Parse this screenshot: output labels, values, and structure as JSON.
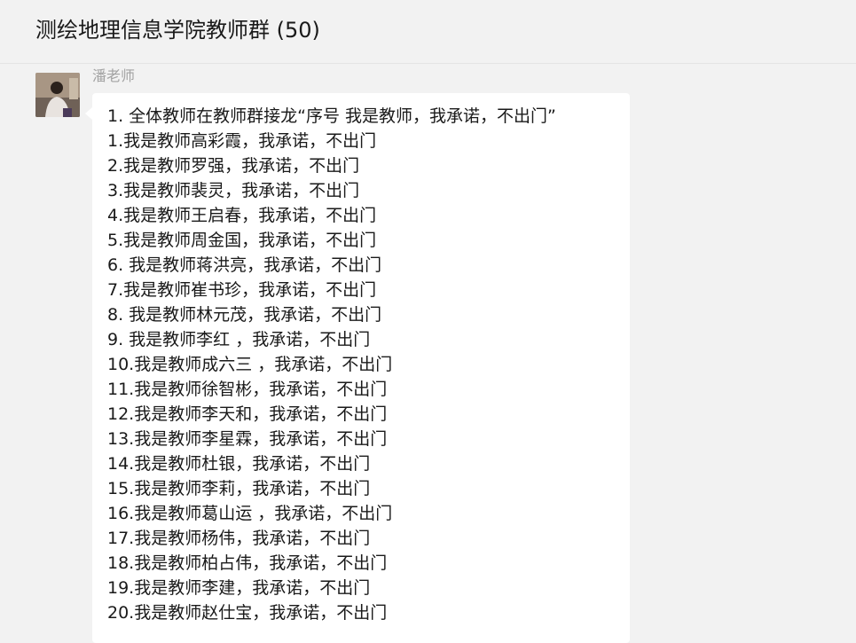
{
  "header": {
    "title": "测绘地理信息学院教师群 (50)"
  },
  "message": {
    "sender": "潘老师",
    "avatar_icon": "person-photo-avatar",
    "lines": [
      "1. 全体教师在教师群接龙“序号 我是教师，我承诺，不出门”",
      "1.我是教师高彩霞，我承诺，不出门",
      "2.我是教师罗强，我承诺，不出门",
      "3.我是教师裴灵，我承诺，不出门",
      "4.我是教师王启春，我承诺，不出门",
      "5.我是教师周金国，我承诺，不出门",
      "6. 我是教师蒋洪亮，我承诺，不出门",
      "7.我是教师崔书珍，我承诺，不出门",
      "8. 我是教师林元茂，我承诺，不出门",
      "9. 我是教师李红 ，我承诺，不出门",
      "10.我是教师成六三 ，我承诺，不出门",
      "11.我是教师徐智彬，我承诺，不出门",
      "12.我是教师李天和，我承诺，不出门",
      "13.我是教师李星霖，我承诺，不出门",
      "14.我是教师杜银，我承诺，不出门",
      "15.我是教师李莉，我承诺，不出门",
      "16.我是教师葛山运 ，我承诺，不出门",
      "17.我是教师杨伟，我承诺，不出门",
      "18.我是教师柏占伟，我承诺，不出门",
      "19.我是教师李建，我承诺，不出门",
      "20.我是教师赵仕宝，我承诺，不出门"
    ]
  }
}
